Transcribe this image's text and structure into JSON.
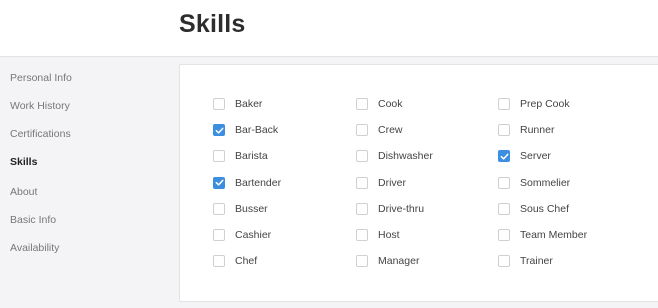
{
  "page_title": "Skills",
  "sidebar": {
    "items": [
      {
        "label": "Personal Info",
        "active": false
      },
      {
        "label": "Work History",
        "active": false
      },
      {
        "label": "Certifications",
        "active": false
      },
      {
        "label": "Skills",
        "active": true
      },
      {
        "label": "About",
        "active": false
      },
      {
        "label": "Basic Info",
        "active": false
      },
      {
        "label": "Availability",
        "active": false
      }
    ]
  },
  "skills": {
    "columns": [
      [
        {
          "label": "Baker",
          "checked": false
        },
        {
          "label": "Bar-Back",
          "checked": true
        },
        {
          "label": "Barista",
          "checked": false
        },
        {
          "label": "Bartender",
          "checked": true
        },
        {
          "label": "Busser",
          "checked": false
        },
        {
          "label": "Cashier",
          "checked": false
        },
        {
          "label": "Chef",
          "checked": false
        }
      ],
      [
        {
          "label": "Cook",
          "checked": false
        },
        {
          "label": "Crew",
          "checked": false
        },
        {
          "label": "Dishwasher",
          "checked": false
        },
        {
          "label": "Driver",
          "checked": false
        },
        {
          "label": "Drive-thru",
          "checked": false
        },
        {
          "label": "Host",
          "checked": false
        },
        {
          "label": "Manager",
          "checked": false
        }
      ],
      [
        {
          "label": "Prep Cook",
          "checked": false
        },
        {
          "label": "Runner",
          "checked": false
        },
        {
          "label": "Server",
          "checked": true
        },
        {
          "label": "Sommelier",
          "checked": false
        },
        {
          "label": "Sous Chef",
          "checked": false
        },
        {
          "label": "Team Member",
          "checked": false
        },
        {
          "label": "Trainer",
          "checked": false
        }
      ]
    ]
  },
  "colors": {
    "accent": "#3b8fde",
    "background": "#f4f4f6",
    "card": "#ffffff"
  },
  "icons": {
    "checkbox_checked": "check-icon"
  }
}
